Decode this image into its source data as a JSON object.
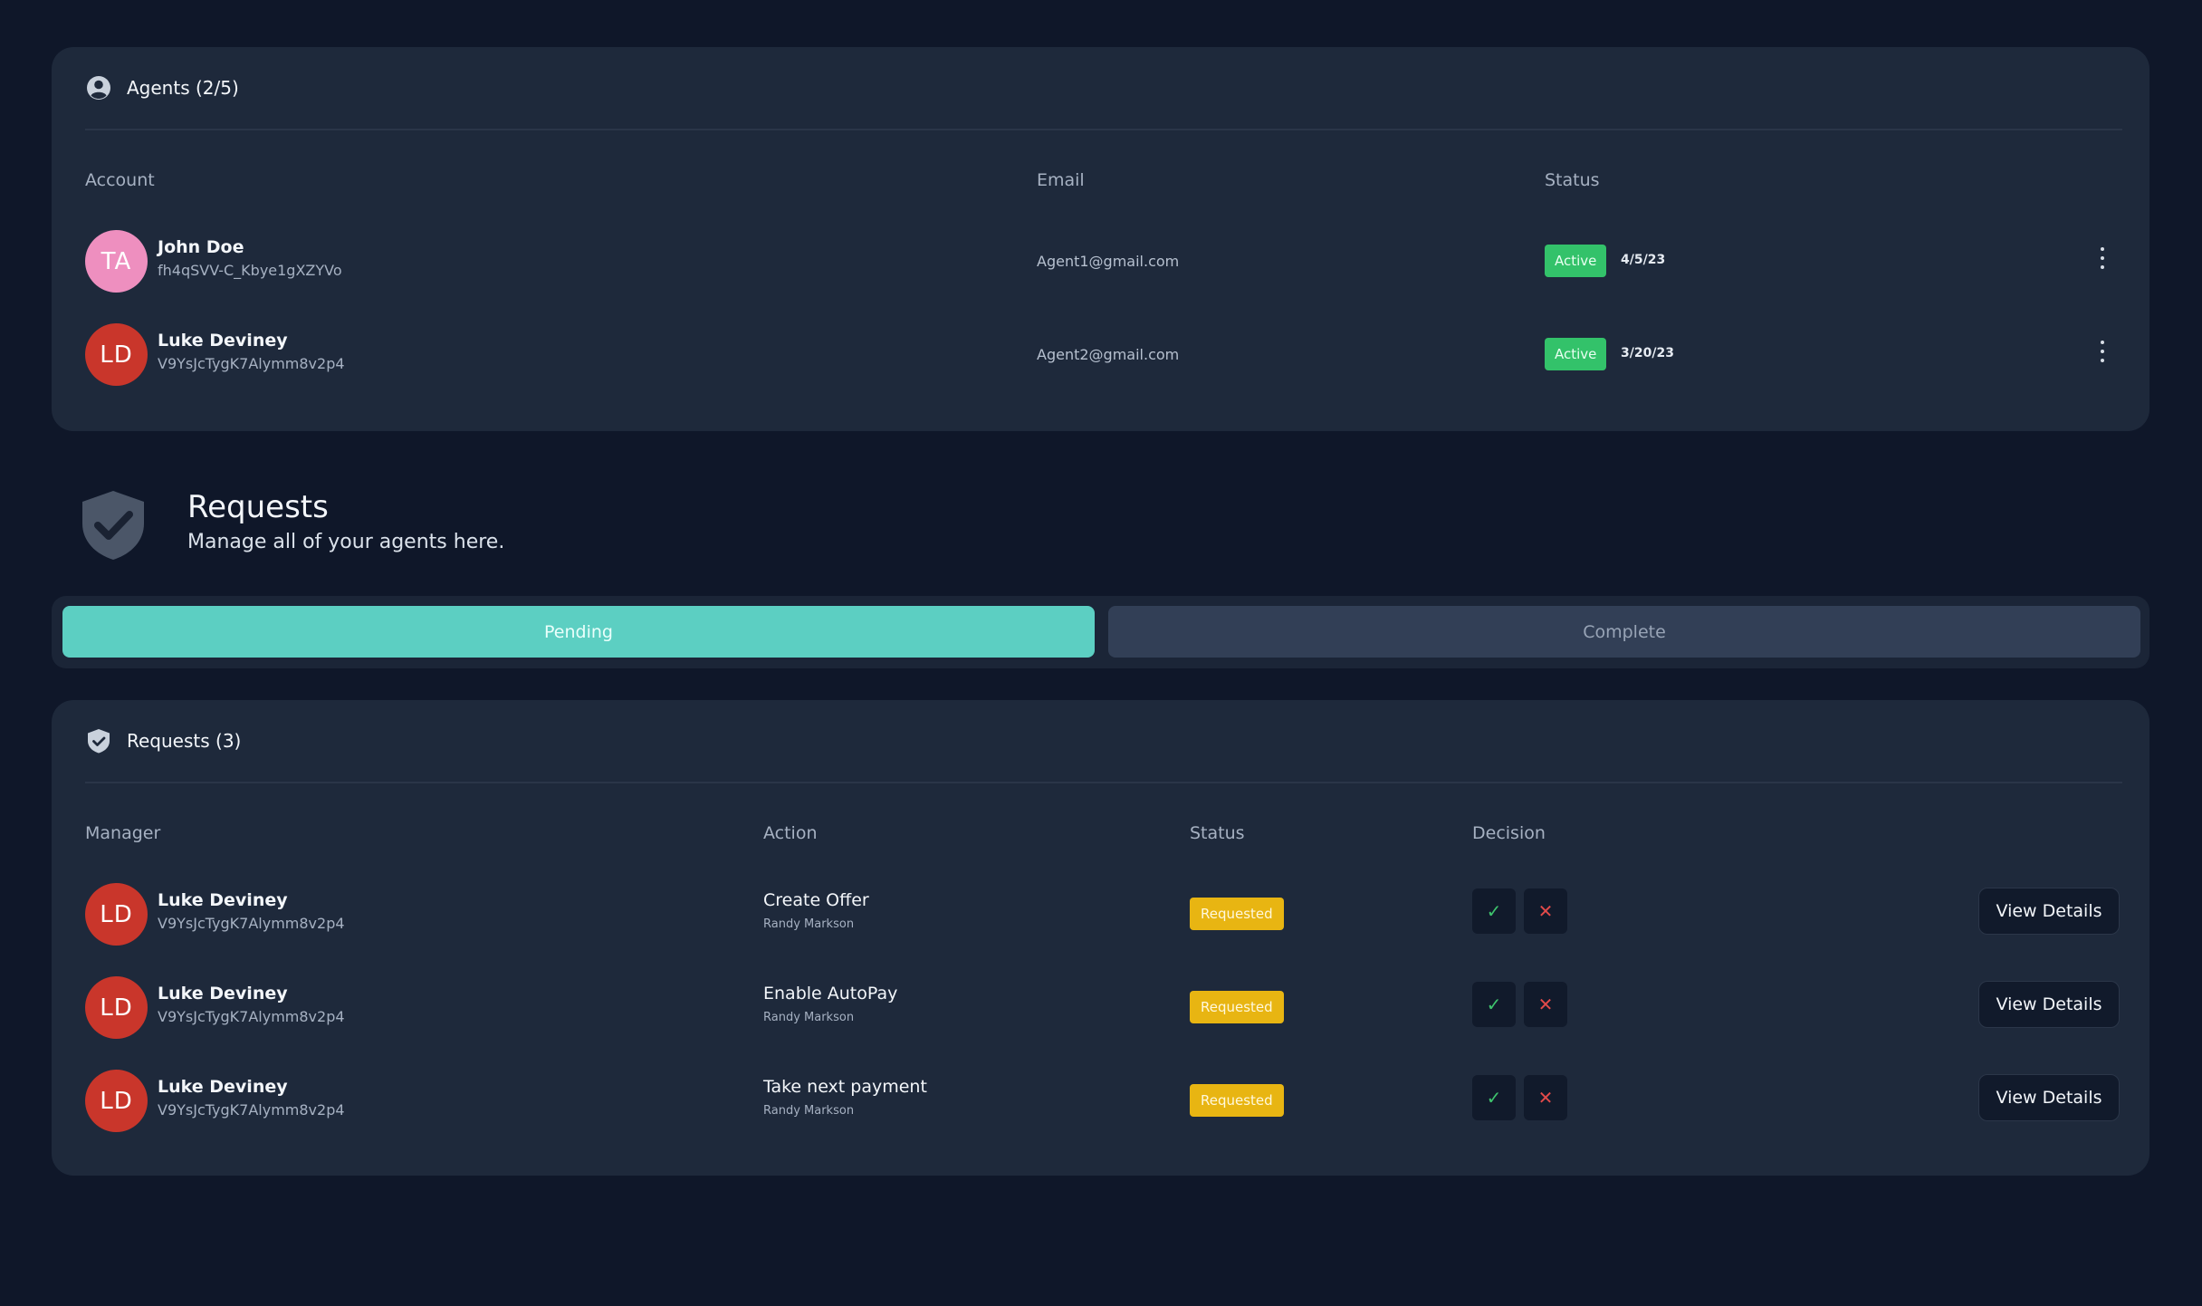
{
  "agents": {
    "title": "Agents (2/5)",
    "columns": {
      "account": "Account",
      "email": "Email",
      "status": "Status"
    },
    "rows": [
      {
        "initials": "TA",
        "name": "John Doe",
        "id": "fh4qSVV-C_Kbye1gXZYVo",
        "email": "Agent1@gmail.com",
        "status": "Active",
        "date": "4/5/23",
        "avatar_color": "#ee8fbf"
      },
      {
        "initials": "LD",
        "name": "Luke Deviney",
        "id": "V9YsJcTygK7Alymm8v2p4",
        "email": "Agent2@gmail.com",
        "status": "Active",
        "date": "3/20/23",
        "avatar_color": "#c9362b"
      }
    ]
  },
  "requests_intro": {
    "title": "Requests",
    "subtitle": "Manage all of your agents here."
  },
  "tabs": [
    {
      "label": "Pending",
      "active": true
    },
    {
      "label": "Complete",
      "active": false
    }
  ],
  "requests": {
    "title": "Requests (3)",
    "columns": {
      "manager": "Manager",
      "action": "Action",
      "status": "Status",
      "decision": "Decision"
    },
    "approve_glyph": "✓",
    "reject_glyph": "✕",
    "view_label": "View Details",
    "rows": [
      {
        "initials": "LD",
        "name": "Luke Deviney",
        "id": "V9YsJcTygK7Alymm8v2p4",
        "action": "Create Offer",
        "action_by": "Randy Markson",
        "status": "Requested"
      },
      {
        "initials": "LD",
        "name": "Luke Deviney",
        "id": "V9YsJcTygK7Alymm8v2p4",
        "action": "Enable AutoPay",
        "action_by": "Randy Markson",
        "status": "Requested"
      },
      {
        "initials": "LD",
        "name": "Luke Deviney",
        "id": "V9YsJcTygK7Alymm8v2p4",
        "action": "Take next payment",
        "action_by": "Randy Markson",
        "status": "Requested"
      }
    ]
  },
  "colors": {
    "background": "#0f1729",
    "card": "#1e293b",
    "accent_teal": "#5ccfc2",
    "active_green": "#33c26a",
    "requested_yellow": "#e8b512",
    "approve_green": "#3ec46d",
    "reject_red": "#e24a4a"
  },
  "icons": {
    "agents_header": "user-circle-icon",
    "requests_big": "shield-check-icon",
    "requests_header": "shield-check-icon",
    "row_menu": "kebab-menu-icon"
  }
}
